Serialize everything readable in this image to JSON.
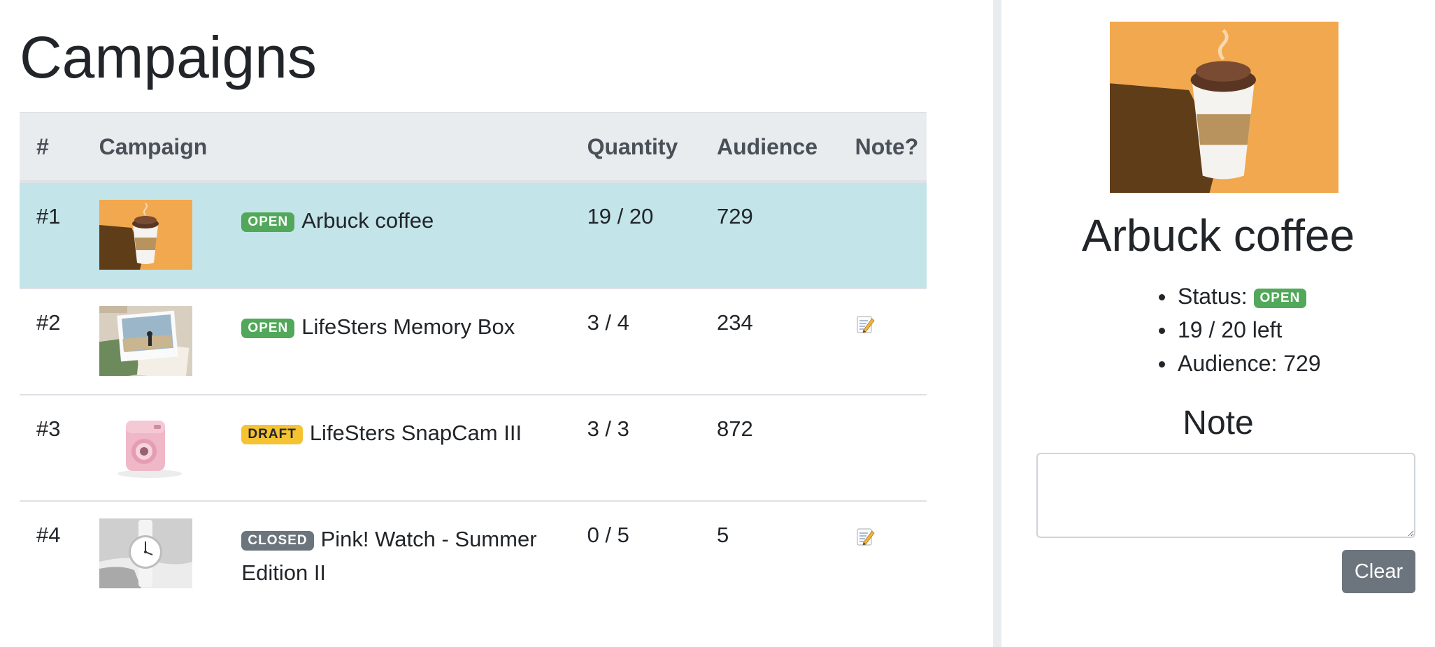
{
  "page": {
    "title": "Campaigns"
  },
  "table": {
    "headers": {
      "num": "#",
      "campaign": "Campaign",
      "quantity": "Quantity",
      "audience": "Audience",
      "note": "Note?"
    },
    "rows": [
      {
        "num": "#1",
        "status": "OPEN",
        "status_color": "#52a85a",
        "name": "Arbuck coffee",
        "quantity": "19 / 20",
        "audience": "729",
        "has_note": false,
        "thumbnail": "coffee-cup-image",
        "selected": true
      },
      {
        "num": "#2",
        "status": "OPEN",
        "status_color": "#52a85a",
        "name": "LifeSters Memory Box",
        "quantity": "3 / 4",
        "audience": "234",
        "has_note": true,
        "thumbnail": "photos-image",
        "selected": false
      },
      {
        "num": "#3",
        "status": "DRAFT",
        "status_color": "#f5c232",
        "name": "LifeSters SnapCam III",
        "quantity": "3 / 3",
        "audience": "872",
        "has_note": false,
        "thumbnail": "pink-camera-image",
        "selected": false
      },
      {
        "num": "#4",
        "status": "CLOSED",
        "status_color": "#6c757d",
        "name": "Pink! Watch - Summer Edition II",
        "quantity": "0 / 5",
        "audience": "5",
        "has_note": true,
        "thumbnail": "watch-image",
        "selected": false
      }
    ]
  },
  "detail": {
    "title": "Arbuck coffee",
    "status_label": "Status:",
    "status": "OPEN",
    "left_text": "19 / 20 left",
    "audience_text": "Audience: 729",
    "note_heading": "Note",
    "note_value": "",
    "clear_label": "Clear"
  },
  "colors": {
    "selected_row": "#c3e4e9",
    "header_bg": "#e9ecef",
    "button": "#6c757d",
    "coffee_bg": "#f2a84e"
  }
}
